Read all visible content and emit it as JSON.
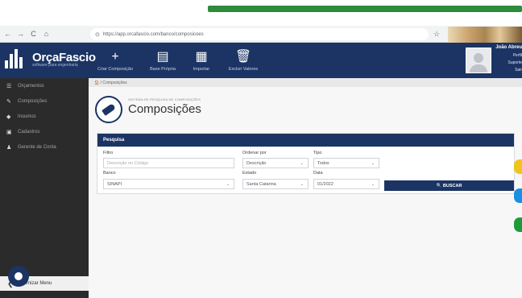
{
  "browser": {
    "url": "https://app.orcafascio.com/banco/composicoes",
    "back_glyph": "←",
    "forward_glyph": "→",
    "reload_glyph": "C",
    "home_glyph": "⌂",
    "star_glyph": "☆"
  },
  "header": {
    "logo_title": "OrçaFascio",
    "logo_sub": "software para engenharia",
    "toolbar": [
      {
        "label": "Criar Composição",
        "glyph": "+",
        "icon": "plus-icon"
      },
      {
        "label": "Base Própria",
        "glyph": "▤",
        "icon": "document-icon"
      },
      {
        "label": "Importar",
        "glyph": "▦",
        "icon": "import-icon"
      },
      {
        "label": "Excluir Valores",
        "glyph": "🗑",
        "icon": "trash-icon"
      }
    ],
    "user": {
      "name": "João Abreu",
      "line1": "Perfil",
      "line2": "Suporte",
      "line3": "Sair"
    }
  },
  "sidebar": {
    "items": [
      {
        "label": "Orçamentos",
        "glyph": "☰",
        "icon": "list-icon"
      },
      {
        "label": "Composições",
        "glyph": "✎",
        "icon": "brush-icon"
      },
      {
        "label": "Insumos",
        "glyph": "◆",
        "icon": "drop-icon"
      },
      {
        "label": "Cadastros",
        "glyph": "▣",
        "icon": "register-icon"
      },
      {
        "label": "Gerente de Conta",
        "glyph": "♟",
        "icon": "person-icon"
      }
    ],
    "footer_label": "Minimizar Menu",
    "collapse_glyph": "❮"
  },
  "breadcrumb": "🏠 / Composições",
  "page": {
    "subtitle": "SISTEMA DE PESQUISA DE COMPOSIÇÕES",
    "title": "Composições"
  },
  "search": {
    "panel_title": "Pesquisa",
    "filtro_label": "Filtro",
    "filtro_placeholder": "Descrição ou Código",
    "ordenar_label": "Ordenar por",
    "ordenar_value": "Descrição",
    "tipo_label": "Tipo",
    "tipo_value": "Todos",
    "banco_label": "Banco",
    "banco_value": "SINAPI",
    "estado_label": "Estado",
    "estado_value": "Santa Catarina",
    "data_label": "Data",
    "data_value": "01/2022",
    "button_label": "🔍 BUSCAR",
    "caret": "⌄"
  },
  "colors": {
    "header": "#1b3463",
    "sidebar": "#2b2b2b",
    "accent_yellow": "#f2c31b",
    "accent_blue": "#1a8fe3",
    "accent_green": "#1f9a3a"
  }
}
